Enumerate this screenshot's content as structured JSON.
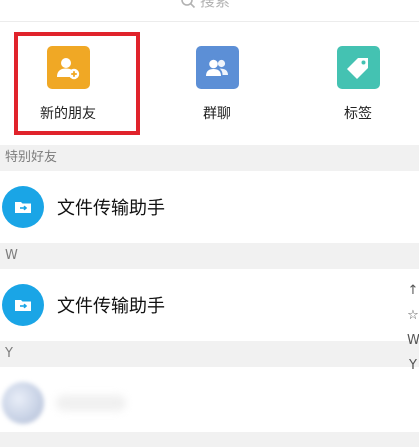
{
  "search": {
    "placeholder": "搜索"
  },
  "shortcuts": [
    {
      "label": "新的朋友",
      "color": "#f0a825",
      "icon": "add-friend-icon"
    },
    {
      "label": "群聊",
      "color": "#5c8fd6",
      "icon": "group-chat-icon"
    },
    {
      "label": "标签",
      "color": "#44c2b2",
      "icon": "tag-icon"
    }
  ],
  "sections": [
    {
      "header": "特别好友",
      "contacts": [
        {
          "name": "文件传输助手",
          "avatar": "file-transfer-icon"
        }
      ]
    },
    {
      "header": "W",
      "contacts": [
        {
          "name": "文件传输助手",
          "avatar": "file-transfer-icon"
        }
      ]
    },
    {
      "header": "Y",
      "contacts": [
        {
          "name": "",
          "avatar": "blurred-avatar"
        }
      ]
    }
  ],
  "alpha_index": [
    "↑",
    "☆",
    "W",
    "Y"
  ],
  "colors": {
    "highlight": "#e0232b",
    "file_transfer": "#1aa5e6",
    "section_bg": "#f1f1f1"
  }
}
